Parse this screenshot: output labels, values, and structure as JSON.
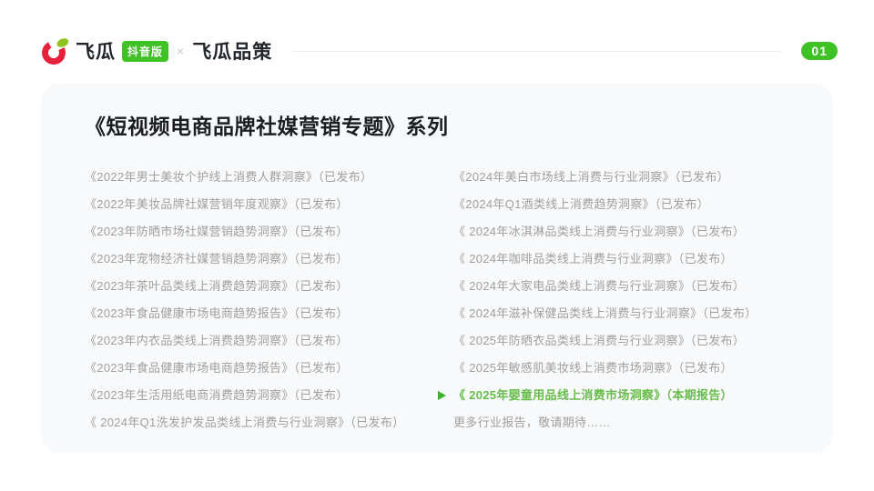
{
  "header": {
    "brand": {
      "name": "飞瓜",
      "edition_badge": "抖音版",
      "separator": "×",
      "partner": "飞瓜品策"
    },
    "page_number": "01"
  },
  "card": {
    "title": "《短视频电商品牌社媒营销专题》系列",
    "left_column": [
      {
        "text": "《2022年男士美妆个护线上消费人群洞察》（已发布）"
      },
      {
        "text": "《2022年美妆品牌社媒营销年度观察》（已发布）"
      },
      {
        "text": "《2023年防晒市场社媒营销趋势洞察》（已发布）"
      },
      {
        "text": "《2023年宠物经济社媒营销趋势洞察》（已发布）"
      },
      {
        "text": "《2023年茶叶品类线上消费趋势洞察》（已发布）"
      },
      {
        "text": "《2023年食品健康市场电商趋势报告》（已发布）"
      },
      {
        "text": "《2023年内衣品类线上消费趋势洞察》（已发布）"
      },
      {
        "text": "《2023年食品健康市场电商趋势报告》（已发布）"
      },
      {
        "text": "《2023年生活用纸电商消费趋势洞察》（已发布）"
      },
      {
        "text": "《 2024年Q1洗发护发品类线上消费与行业洞察》（已发布）"
      }
    ],
    "right_column": [
      {
        "text": "《2024年美白市场线上消费与行业洞察》（已发布）"
      },
      {
        "text": "《2024年Q1酒类线上消费趋势洞察》（已发布）"
      },
      {
        "text": "《 2024年冰淇淋品类线上消费与行业洞察》（已发布）"
      },
      {
        "text": "《 2024年咖啡品类线上消费与行业洞察》（已发布）"
      },
      {
        "text": "《 2024年大家电品类线上消费与行业洞察》（已发布）"
      },
      {
        "text": "《 2024年滋补保健品类线上消费与行业洞察》（已发布）"
      },
      {
        "text": "《 2025年防晒衣品类线上消费与行业洞察》（已发布）"
      },
      {
        "text": "《 2025年敏感肌美妆线上消费市场洞察》（已发布）"
      },
      {
        "text": "《 2025年婴童用品线上消费市场洞察》（本期报告）",
        "highlight": true,
        "icon": "play"
      },
      {
        "text": "更多行业报告，敬请期待……"
      }
    ]
  },
  "colors": {
    "brand_green": "#3ec226",
    "highlight_green": "#67bd4a",
    "play_icon_green": "#3bb427",
    "logo_red": "#e62139",
    "logo_leaf_green": "#8fc31f",
    "item_gray": "#a0a0a0",
    "title_dark": "#1b1d21",
    "card_background": "#f8f9fa"
  }
}
